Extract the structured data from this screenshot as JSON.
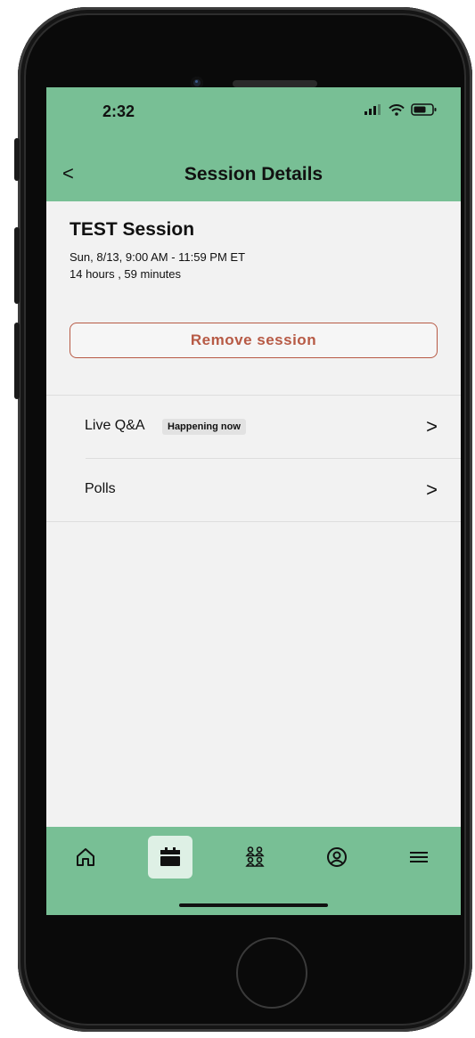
{
  "status_bar": {
    "time": "2:32"
  },
  "header": {
    "back_symbol": "<",
    "title": "Session Details"
  },
  "session": {
    "title": "TEST Session",
    "date_time": "Sun, 8/13, 9:00 AM - 11:59 PM ET",
    "duration": "14 hours , 59 minutes",
    "remove_label": "Remove session"
  },
  "rows": [
    {
      "label": "Live Q&A",
      "badge": "Happening now",
      "chevron": ">"
    },
    {
      "label": "Polls",
      "chevron": ">"
    }
  ],
  "tabbar": {
    "items": [
      {
        "icon": "home-icon",
        "active": false
      },
      {
        "icon": "calendar-icon",
        "active": true
      },
      {
        "icon": "people-icon",
        "active": false
      },
      {
        "icon": "profile-icon",
        "active": false
      },
      {
        "icon": "menu-icon",
        "active": false
      }
    ]
  },
  "colors": {
    "header_green": "#78bf95",
    "remove_accent": "#b75a45",
    "screen_background": "#f2f2f2"
  }
}
